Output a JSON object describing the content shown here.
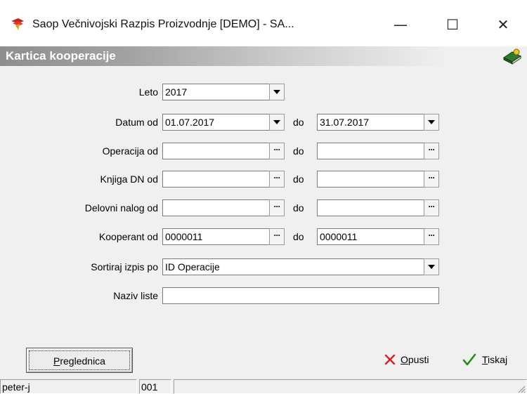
{
  "window": {
    "title": "Saop  Večnivojski Razpis Proizvodnje [DEMO] - SA...",
    "minimize": "—",
    "maximize": "☐",
    "close": "✕"
  },
  "header": {
    "title": "Kartica kooperacije"
  },
  "form": {
    "leto": {
      "label": "Leto",
      "value": "2017"
    },
    "datum": {
      "label": "Datum od",
      "from": "01.07.2017",
      "to_label": "do",
      "to": "31.07.2017"
    },
    "operacija": {
      "label": "Operacija od",
      "from": "",
      "to_label": "do",
      "to": ""
    },
    "knjiga": {
      "label": "Knjiga DN od",
      "from": "",
      "to_label": "do",
      "to": ""
    },
    "nalog": {
      "label": "Delovni nalog od",
      "from": "",
      "to_label": "do",
      "to": ""
    },
    "kooperant": {
      "label": "Kooperant od",
      "from": "0000011",
      "to_label": "do",
      "to": "0000011"
    },
    "sortiraj": {
      "label": "Sortiraj izpis po",
      "value": "ID Operacije"
    },
    "naziv": {
      "label": "Naziv liste",
      "value": ""
    },
    "ellipsis": "···"
  },
  "buttons": {
    "pregled_first": "P",
    "pregled_rest": "reglednica",
    "opusti_first": "O",
    "opusti_rest": "pusti",
    "tiskaj_first": "T",
    "tiskaj_rest": "iskaj"
  },
  "status": {
    "user": "peter-j",
    "code": "001",
    "message": ""
  },
  "colors": {
    "cancel": "#d42020",
    "ok": "#2a8a1a"
  }
}
